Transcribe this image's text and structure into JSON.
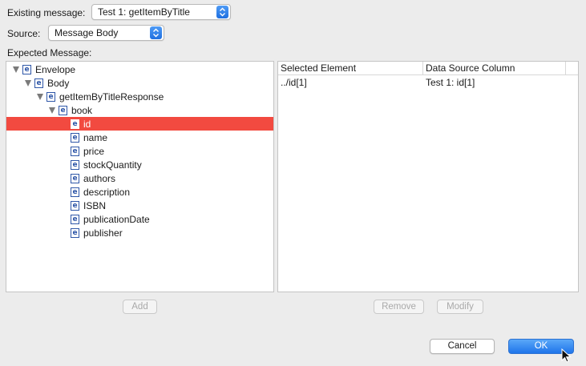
{
  "header": {
    "existing_label": "Existing message:",
    "existing_value": "Test 1: getItemByTitle",
    "source_label": "Source:",
    "source_value": "Message Body",
    "expected_label": "Expected Message:"
  },
  "tree": {
    "nodes": [
      {
        "label": "Envelope",
        "depth": 0,
        "expanded": true
      },
      {
        "label": "Body",
        "depth": 1,
        "expanded": true
      },
      {
        "label": "getItemByTitleResponse",
        "depth": 2,
        "expanded": true
      },
      {
        "label": "book",
        "depth": 3,
        "expanded": true
      },
      {
        "label": "id",
        "depth": 4,
        "selected": true
      },
      {
        "label": "name",
        "depth": 4
      },
      {
        "label": "price",
        "depth": 4
      },
      {
        "label": "stockQuantity",
        "depth": 4
      },
      {
        "label": "authors",
        "depth": 4
      },
      {
        "label": "description",
        "depth": 4
      },
      {
        "label": "ISBN",
        "depth": 4
      },
      {
        "label": "publicationDate",
        "depth": 4
      },
      {
        "label": "publisher",
        "depth": 4
      }
    ],
    "element_icon_letter": "e"
  },
  "mapping_table": {
    "columns": [
      "Selected Element",
      "Data Source Column"
    ],
    "rows": [
      [
        "../id[1]",
        "Test 1: id[1]"
      ]
    ]
  },
  "buttons": {
    "add": "Add",
    "remove": "Remove",
    "modify": "Modify",
    "cancel": "Cancel",
    "ok": "OK"
  },
  "colors": {
    "selection": "#f24a40",
    "accent": "#1f75ea"
  }
}
